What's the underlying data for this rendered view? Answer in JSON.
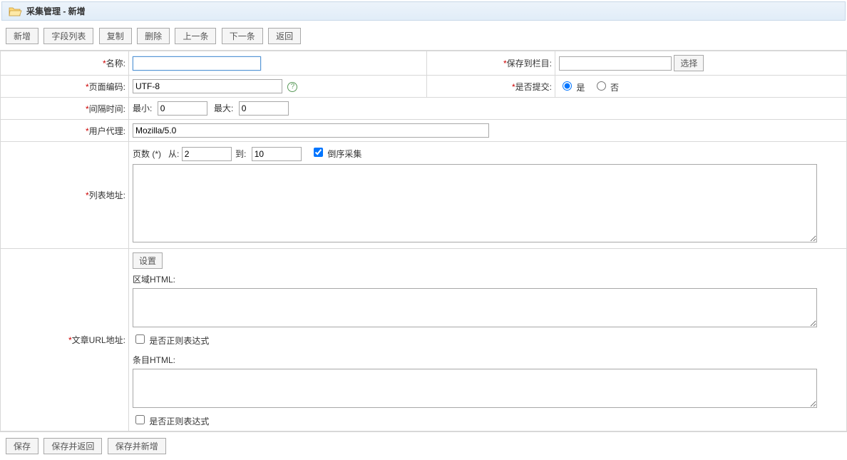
{
  "header": {
    "title": "采集管理 - 新增"
  },
  "toolbar": {
    "new": "新增",
    "field_list": "字段列表",
    "copy": "复制",
    "delete": "删除",
    "prev": "上一条",
    "next": "下一条",
    "back": "返回"
  },
  "form": {
    "name_label": "名称:",
    "name_value": "",
    "save_to_label": "保存到栏目:",
    "save_to_value": "",
    "select_button": "选择",
    "encoding_label": "页面编码:",
    "encoding_value": "UTF-8",
    "auto_submit_label": "是否提交:",
    "radio_yes": "是",
    "radio_no": "否",
    "interval_label": "间隔时间:",
    "interval_min_label": "最小:",
    "interval_min_value": "0",
    "interval_max_label": "最大:",
    "interval_max_value": "0",
    "user_agent_label": "用户代理:",
    "user_agent_value": "Mozilla/5.0",
    "list_url_label": "列表地址:",
    "page_count_label": "页数 (*)",
    "from_label": "从:",
    "from_value": "2",
    "to_label": "到:",
    "to_value": "10",
    "reverse_collect": "倒序采集",
    "list_textarea_value": "",
    "article_url_label": "文章URL地址:",
    "settings_button": "设置",
    "area_html_label": "区域HTML:",
    "area_html_value": "",
    "area_regex_label": "是否正则表达式",
    "item_html_label": "条目HTML:",
    "item_html_value": "",
    "item_regex_label": "是否正则表达式"
  },
  "footer": {
    "save": "保存",
    "save_and_back": "保存并返回",
    "save_and_new": "保存并新增"
  }
}
